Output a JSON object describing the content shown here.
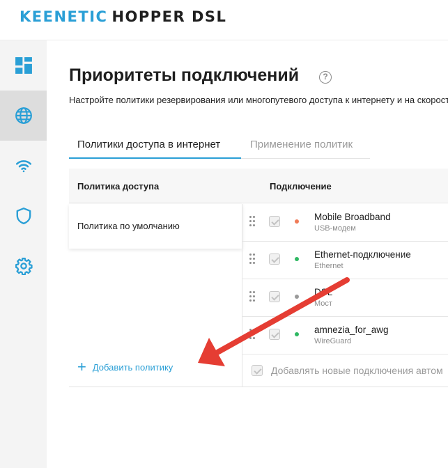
{
  "brand": {
    "name": "KEENETIC",
    "model": "HOPPER DSL"
  },
  "sidebar": {
    "items": [
      {
        "icon": "dashboard-icon",
        "active": false
      },
      {
        "icon": "globe-icon",
        "active": true
      },
      {
        "icon": "wifi-icon",
        "active": false
      },
      {
        "icon": "shield-icon",
        "active": false
      },
      {
        "icon": "gear-icon",
        "active": false
      }
    ]
  },
  "page": {
    "title": "Приоритеты подключений",
    "help": "?",
    "subtitle": "Настройте политики резервирования или многопутевого доступа к интернету и на скорости."
  },
  "tabs": [
    {
      "label": "Политики доступа в интернет",
      "active": true
    },
    {
      "label": "Применение политик",
      "active": false
    }
  ],
  "table": {
    "headers": {
      "policy": "Политика доступа",
      "connection": "Подключение"
    },
    "policy": "Политика по умолчанию",
    "connections": [
      {
        "name": "Mobile Broadband",
        "type": "USB-модем",
        "status_color": "#f07b57",
        "checked": true
      },
      {
        "name": "Ethernet-подключение",
        "type": "Ethernet",
        "status_color": "#2fb863",
        "checked": true
      },
      {
        "name": "DSL",
        "type": "Мост",
        "status_color": "#9a9a9a",
        "checked": true
      },
      {
        "name": "amnezia_for_awg",
        "type": "WireGuard",
        "status_color": "#2fb863",
        "checked": true
      }
    ],
    "auto_add": "Добавлять новые подключения автом"
  },
  "add_policy": {
    "plus": "+",
    "label": "Добавить политику"
  },
  "annotation": {
    "color": "#e53d33"
  },
  "colors": {
    "accent": "#2a9fd6"
  }
}
